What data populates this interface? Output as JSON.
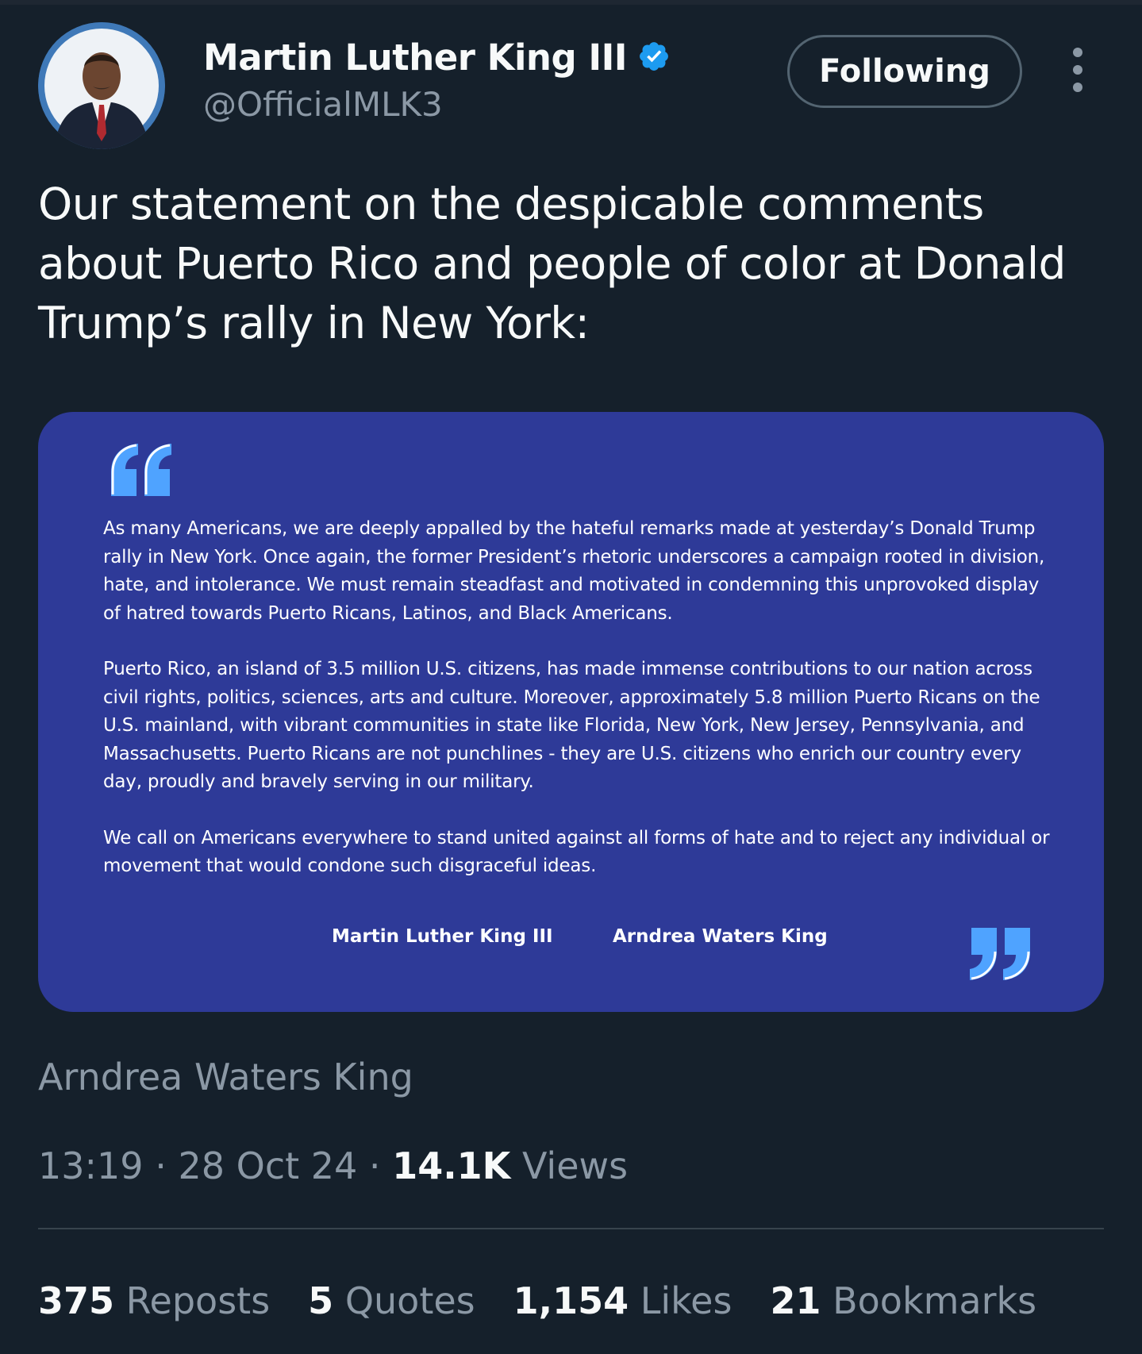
{
  "author": {
    "display_name": "Martin Luther King III",
    "handle": "@OfficialMLK3",
    "verified_icon": "verified-badge-icon",
    "avatar": "avatar"
  },
  "actions": {
    "follow_label": "Following",
    "more_icon": "more-vertical-icon"
  },
  "tweet": {
    "text": "Our statement on the despicable comments about Puerto Rico and people of color at Donald Trump’s rally in New York:"
  },
  "media": {
    "paragraphs": [
      "As many Americans, we are deeply appalled by the hateful remarks made at yesterday’s Donald Trump rally in New York. Once again, the former President’s rhetoric underscores a campaign rooted in division, hate, and intolerance. We must remain steadfast and motivated in condemning this unprovoked display of hatred towards Puerto Ricans, Latinos, and Black Americans.",
      "Puerto Rico, an island of 3.5 million U.S. citizens, has made immense contributions to our nation across civil rights, politics, sciences, arts and culture. Moreover, approximately 5.8 million Puerto Ricans on the U.S. mainland, with vibrant communities in state like Florida, New York, New Jersey, Pennsylvania, and Massachusetts. Puerto Ricans are not punchlines - they are U.S. citizens who enrich our country every day, proudly and bravely serving in our military.",
      "We call on Americans everywhere to stand united against all forms of hate and to reject any individual or movement that would condone such disgraceful ideas."
    ],
    "signatures": [
      "Martin Luther King III",
      "Arndrea Waters King"
    ],
    "background_color": "#2e3a98",
    "quote_color": "#4fa3ff"
  },
  "caption": "Arndrea Waters King",
  "meta": {
    "time": "13:19",
    "separator": " · ",
    "date": "28 Oct 24",
    "views_count": "14.1K",
    "views_label": "Views"
  },
  "stats": [
    {
      "count": "375",
      "label": "Reposts"
    },
    {
      "count": "5",
      "label": "Quotes"
    },
    {
      "count": "1,154",
      "label": "Likes"
    },
    {
      "count": "21",
      "label": "Bookmarks"
    }
  ],
  "colors": {
    "background": "#15202b",
    "primary_text": "#f7f9f9",
    "secondary_text": "#8b98a5",
    "verified_blue": "#1d9bf0",
    "border": "#536471"
  }
}
